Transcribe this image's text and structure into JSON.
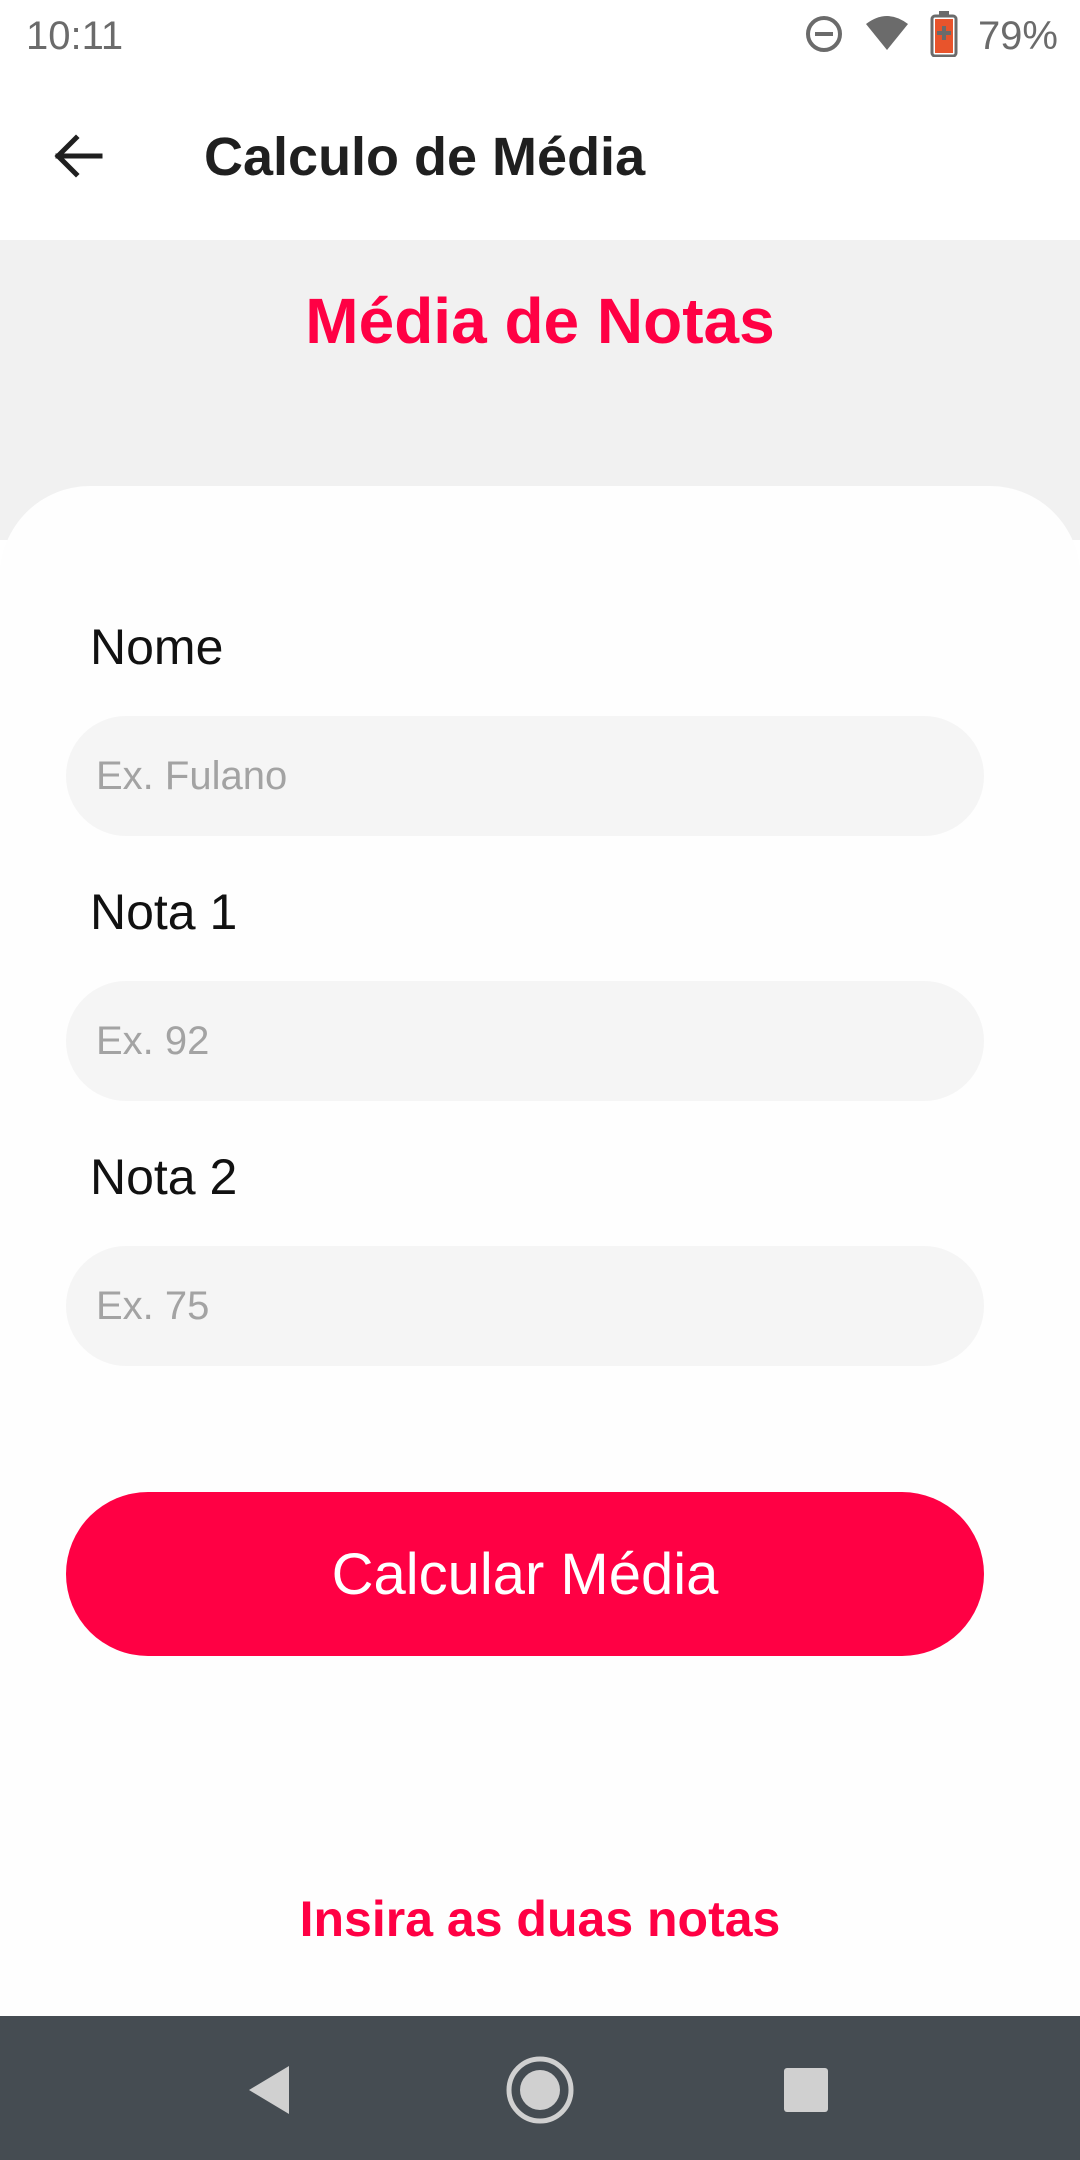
{
  "status_bar": {
    "time": "10:11",
    "battery_percent": "79%",
    "icons": [
      "do-not-disturb-icon",
      "wifi-icon",
      "battery-icon"
    ]
  },
  "app_bar": {
    "title": "Calculo de Média",
    "back_icon": "arrow-left-icon"
  },
  "header": {
    "title": "Média de Notas"
  },
  "form": {
    "name": {
      "label": "Nome",
      "placeholder": "Ex. Fulano",
      "value": ""
    },
    "grade1": {
      "label": "Nota 1",
      "placeholder": "Ex. 92",
      "value": ""
    },
    "grade2": {
      "label": "Nota 2",
      "placeholder": "Ex. 75",
      "value": ""
    },
    "submit_label": "Calcular Média"
  },
  "message": "Insira as duas notas",
  "nav_bar": {
    "icons": [
      "back-triangle-icon",
      "home-circle-icon",
      "recents-square-icon"
    ]
  },
  "colors": {
    "accent": "#ff0044",
    "header_bg": "#f1f1f1",
    "input_bg": "#f5f5f5",
    "nav_bg": "#454c52"
  }
}
